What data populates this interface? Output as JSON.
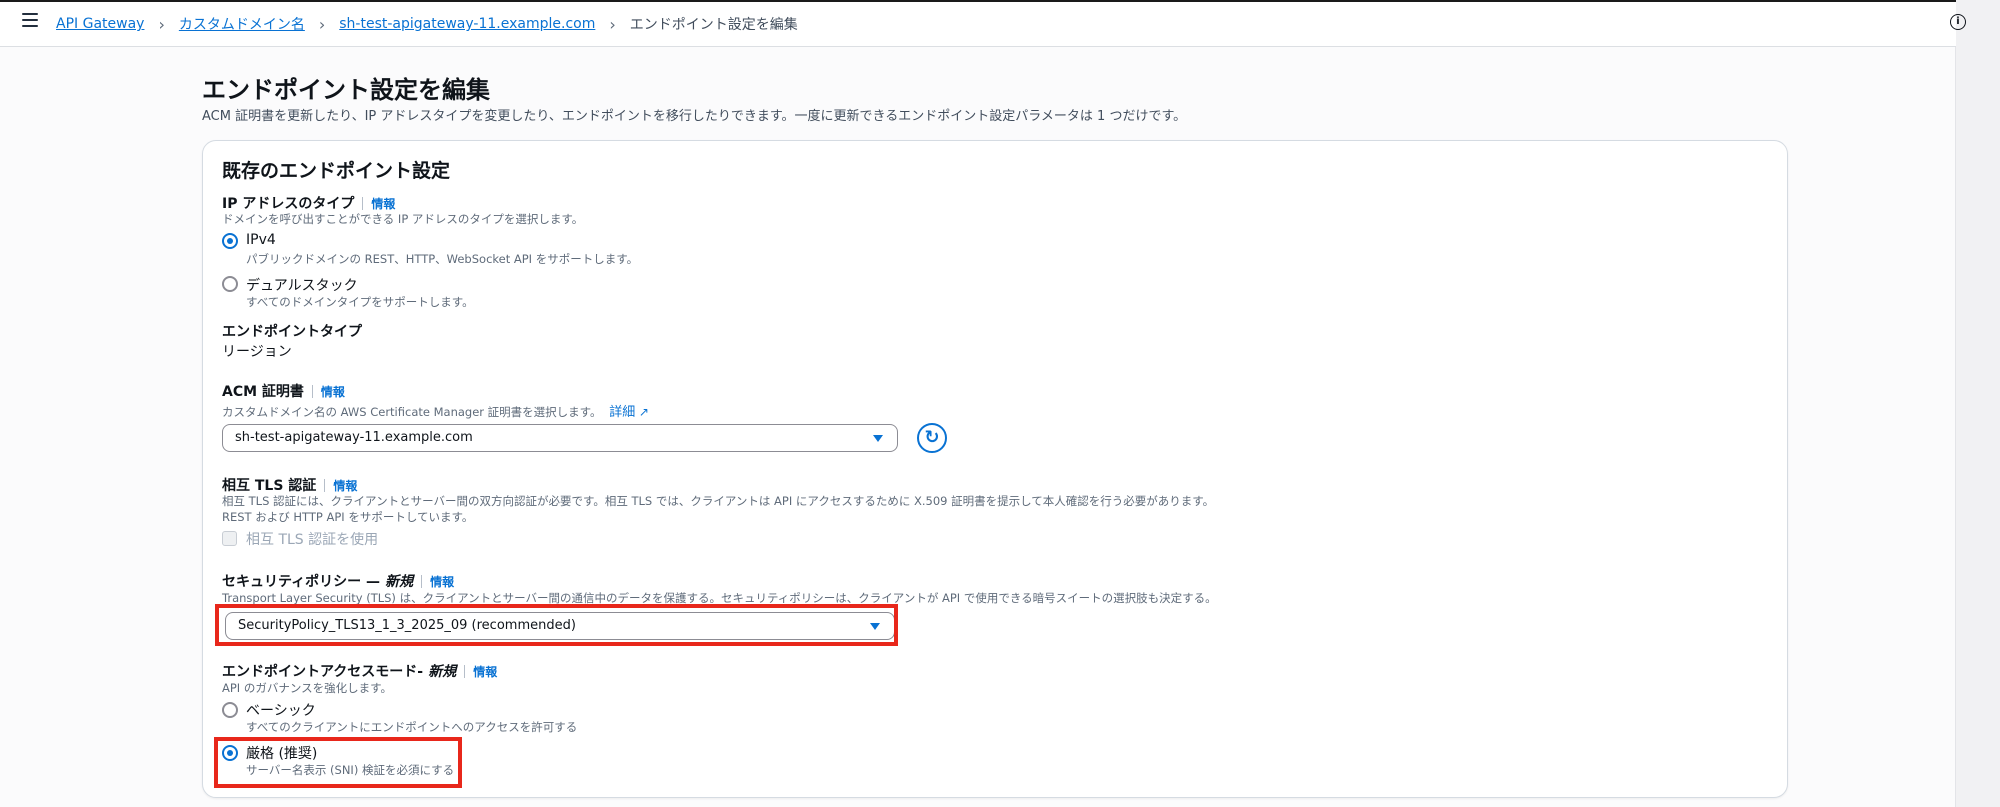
{
  "breadcrumb": {
    "items": [
      "API Gateway",
      "カスタムドメイン名",
      "sh-test-apigateway-11.example.com"
    ],
    "current": "エンドポイント設定を編集"
  },
  "page": {
    "title": "エンドポイント設定を編集",
    "description": "ACM 証明書を更新したり、IP アドレスタイプを変更したり、エンドポイントを移行したりできます。一度に更新できるエンドポイント設定パラメータは 1 つだけです。"
  },
  "card": {
    "title": "既存のエンドポイント設定",
    "info_label": "情報",
    "ip_type": {
      "label": "IP アドレスのタイプ",
      "hint": "ドメインを呼び出すことができる IP アドレスのタイプを選択します。",
      "options": [
        {
          "label": "IPv4",
          "desc": "パブリックドメインの REST、HTTP、WebSocket API をサポートします。",
          "checked": true
        },
        {
          "label": "デュアルスタック",
          "desc": "すべてのドメインタイプをサポートします。",
          "checked": false
        }
      ]
    },
    "endpoint_type": {
      "label": "エンドポイントタイプ",
      "value": "リージョン"
    },
    "acm": {
      "label": "ACM 証明書",
      "hint": "カスタムドメイン名の AWS Certificate Manager 証明書を選択します。",
      "more_link": "詳細",
      "selected": "sh-test-apigateway-11.example.com"
    },
    "mtls": {
      "label": "相互 TLS 認証",
      "hint1": "相互 TLS 認証には、クライアントとサーバー間の双方向認証が必要です。相互 TLS では、クライアントは API にアクセスするために X.509 証明書を提示して本人確認を行う必要があります。",
      "hint2": "REST および HTTP API をサポートしています。",
      "checkbox_label": "相互 TLS 認証を使用"
    },
    "security_policy": {
      "label": "セキュリティポリシー —",
      "badge": "新規",
      "hint": "Transport Layer Security (TLS) は、クライアントとサーバー間の通信中のデータを保護する。セキュリティポリシーは、クライアントが API で使用できる暗号スイートの選択肢も決定する。",
      "selected": "SecurityPolicy_TLS13_1_3_2025_09 (recommended)"
    },
    "access_mode": {
      "label": "エンドポイントアクセスモード-",
      "badge": "新規",
      "hint": "API のガバナンスを強化します。",
      "options": [
        {
          "label": "ベーシック",
          "desc": "すべてのクライアントにエンドポイントへのアクセスを許可する",
          "checked": false
        },
        {
          "label": "厳格 (推奨)",
          "desc": "サーバー名表示 (SNI) 検証を必須にする",
          "checked": true
        }
      ]
    }
  },
  "colors": {
    "link": "#0972d3",
    "highlight": "#e8271b",
    "text": "#0f141a"
  },
  "icons": [
    "menu-icon",
    "chevron-right-icon",
    "info-circle-icon",
    "external-link-icon",
    "refresh-icon",
    "caret-down-icon"
  ]
}
